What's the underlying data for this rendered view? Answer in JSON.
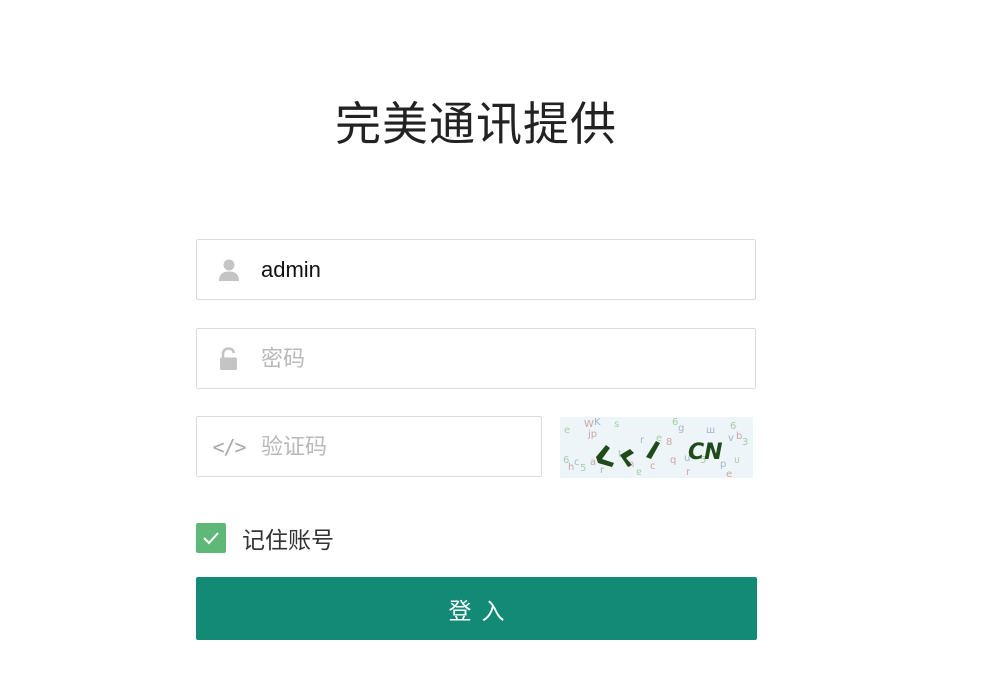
{
  "title": "完美通讯提供",
  "username": {
    "value": "admin",
    "icon": "user-icon"
  },
  "password": {
    "placeholder": "密码",
    "icon": "unlock-icon"
  },
  "captcha": {
    "placeholder": "验证码",
    "icon": "code-icon",
    "icon_glyph": "</>",
    "image_text": "CN"
  },
  "remember": {
    "label": "记住账号",
    "checked": true,
    "icon": "check-icon",
    "color": "#5fb878"
  },
  "login_button": {
    "label": "登入",
    "color": "#138a76"
  }
}
